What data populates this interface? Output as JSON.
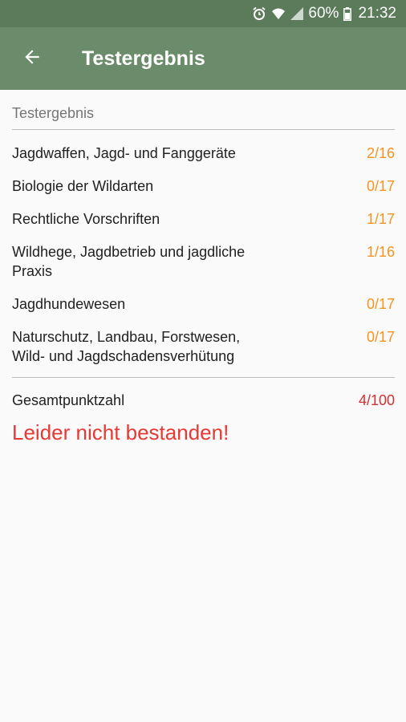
{
  "status_bar": {
    "battery": "60%",
    "time": "21:32",
    "icons": [
      "alarm-icon",
      "wifi-icon",
      "signal-icon",
      "battery-icon"
    ]
  },
  "app_bar": {
    "title": "Testergebnis",
    "back_icon": "arrow-left-icon"
  },
  "section_header": "Testergebnis",
  "results": [
    {
      "label": "Jagdwaffen, Jagd- und Fanggeräte",
      "score": "2/16"
    },
    {
      "label": "Biologie der Wildarten",
      "score": "0/17"
    },
    {
      "label": "Rechtliche Vorschriften",
      "score": "1/17"
    },
    {
      "label": "Wildhege, Jagdbetrieb und jagdliche Praxis",
      "score": "1/16"
    },
    {
      "label": "Jagdhundewesen",
      "score": "0/17"
    },
    {
      "label": "Naturschutz, Landbau, Forstwesen, Wild- und Jagdschadensverhütung",
      "score": "0/17"
    }
  ],
  "total": {
    "label": "Gesamtpunktzahl",
    "score": "4/100"
  },
  "result_message": "Leider nicht bestanden!",
  "colors": {
    "status_bar": "#5b7b5b",
    "app_bar": "#6b8c6b",
    "score": "#f7931e",
    "fail": "#e53935"
  }
}
